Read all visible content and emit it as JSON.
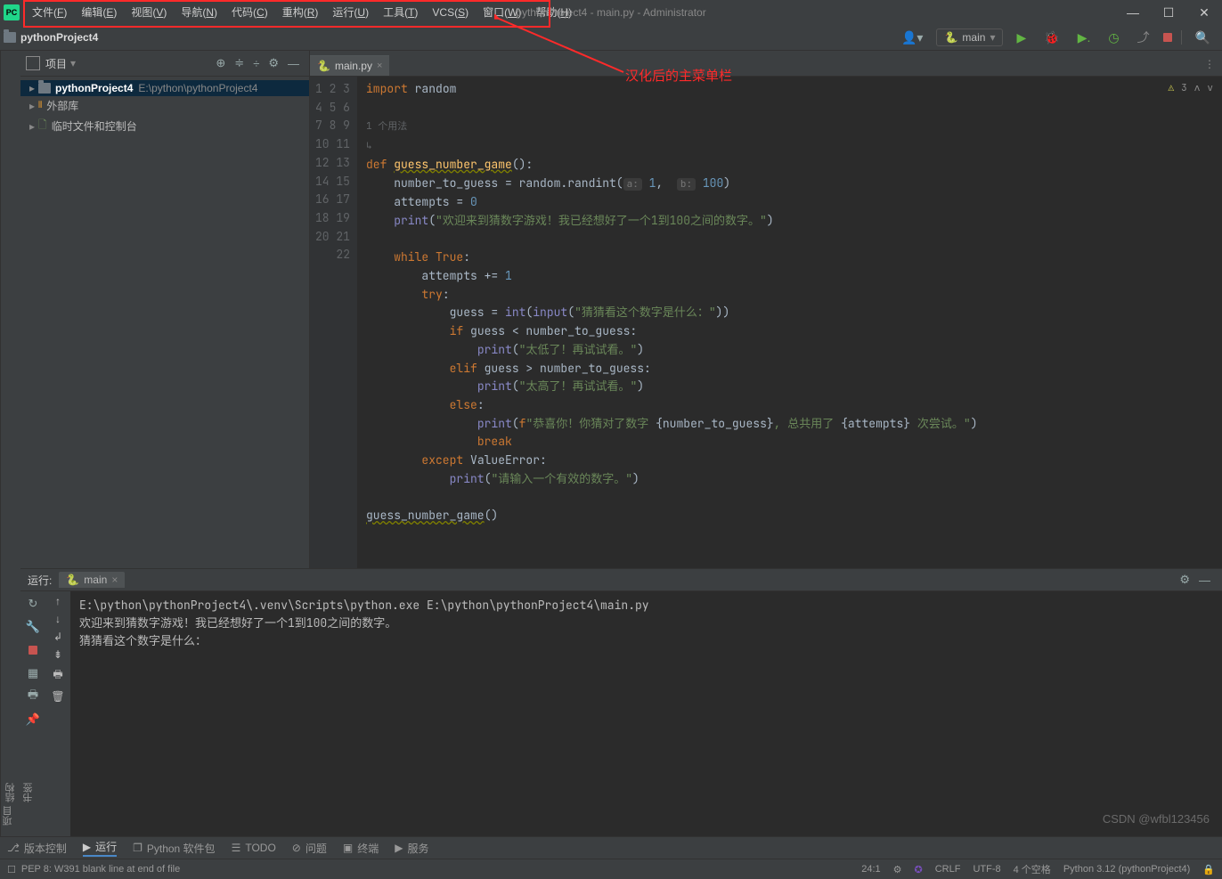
{
  "title": "pythonProject4 - main.py - Administrator",
  "menu": [
    "文件(F)",
    "编辑(E)",
    "视图(V)",
    "导航(N)",
    "代码(C)",
    "重构(R)",
    "运行(U)",
    "工具(T)",
    "VCS(S)",
    "窗口(W)",
    "帮助(H)"
  ],
  "breadcrumb": "pythonProject4",
  "run_config": "main",
  "annotation": "汉化后的主菜单栏",
  "project": {
    "title": "项目",
    "root_name": "pythonProject4",
    "root_path": "E:\\python\\pythonProject4",
    "ext_lib": "外部库",
    "scratch": "临时文件和控制台"
  },
  "editor": {
    "tab": "main.py",
    "usage_lens": "1 个用法",
    "inspection": "3",
    "lines": [
      {
        "n": "1",
        "html": "<span class='kw'>import</span> random"
      },
      {
        "n": "2",
        "html": ""
      },
      {
        "n": " ",
        "html": "<span style='color:#606366;font-size:11px'>1 个用法</span>"
      },
      {
        "n": " ",
        "html": "<span style='color:#606366;font-size:11px'>↳</span>"
      },
      {
        "n": "3",
        "html": "<span class='kw'>def </span><span class='fn warn-underline'>guess_number_game</span>():"
      },
      {
        "n": "4",
        "html": "    number_to_guess = random.randint(<span class='param-hint'>a:</span> <span class='num'>1</span>,  <span class='param-hint'>b:</span> <span class='num'>100</span>)"
      },
      {
        "n": "5",
        "html": "    attempts = <span class='num'>0</span>"
      },
      {
        "n": "6",
        "html": "    <span class='builtin'>print</span>(<span class='str'>\"欢迎来到猜数字游戏！我已经想好了一个1到100之间的数字。\"</span>)"
      },
      {
        "n": "7",
        "html": ""
      },
      {
        "n": "8",
        "html": "    <span class='kw'>while True</span>:"
      },
      {
        "n": "9",
        "html": "        attempts += <span class='num'>1</span>"
      },
      {
        "n": "10",
        "html": "        <span class='kw'>try</span>:"
      },
      {
        "n": "11",
        "html": "            guess = <span class='builtin'>int</span>(<span class='builtin'>input</span>(<span class='str'>\"猜猜看这个数字是什么：\"</span>))"
      },
      {
        "n": "12",
        "html": "            <span class='kw'>if</span> guess &lt; number_to_guess:"
      },
      {
        "n": "13",
        "html": "                <span class='builtin'>print</span>(<span class='str'>\"太低了！再试试看。\"</span>)"
      },
      {
        "n": "14",
        "html": "            <span class='kw'>elif</span> guess &gt; number_to_guess:"
      },
      {
        "n": "15",
        "html": "                <span class='builtin'>print</span>(<span class='str'>\"太高了！再试试看。\"</span>)"
      },
      {
        "n": "16",
        "html": "            <span class='kw'>else</span>:"
      },
      {
        "n": "17",
        "html": "                <span class='builtin'>print</span>(<span class='kw'>f</span><span class='str'>\"恭喜你！你猜对了数字 </span>{number_to_guess}<span class='str'>, 总共用了 </span>{attempts}<span class='str'> 次尝试。\"</span>)"
      },
      {
        "n": "18",
        "html": "                <span class='kw'>break</span>"
      },
      {
        "n": "19",
        "html": "        <span class='kw'>except </span>ValueError:"
      },
      {
        "n": "20",
        "html": "            <span class='builtin'>print</span>(<span class='str'>\"请输入一个有效的数字。\"</span>)"
      },
      {
        "n": "21",
        "html": ""
      },
      {
        "n": "22",
        "html": "<span class='warn-underline'>guess_number_game</span>()"
      }
    ]
  },
  "run": {
    "label": "运行:",
    "tab": "main",
    "output": [
      "E:\\python\\pythonProject4\\.venv\\Scripts\\python.exe E:\\python\\pythonProject4\\main.py",
      "欢迎来到猜数字游戏！我已经想好了一个1到100之间的数字。",
      "猜猜看这个数字是什么："
    ]
  },
  "bottom_tabs": {
    "vcs": "版本控制",
    "run": "运行",
    "packages": "Python 软件包",
    "todo": "TODO",
    "problems": "问题",
    "terminal": "终端",
    "services": "服务"
  },
  "left_vert": {
    "project": "项目",
    "bookmark": "书签",
    "structure": "结构"
  },
  "status": {
    "msg": "PEP 8: W391 blank line at end of file",
    "pos": "24:1",
    "crlf": "CRLF",
    "enc": "UTF-8",
    "indent": "4 个空格",
    "interp": "Python 3.12 (pythonProject4)"
  },
  "watermark": "CSDN @wfbl123456"
}
